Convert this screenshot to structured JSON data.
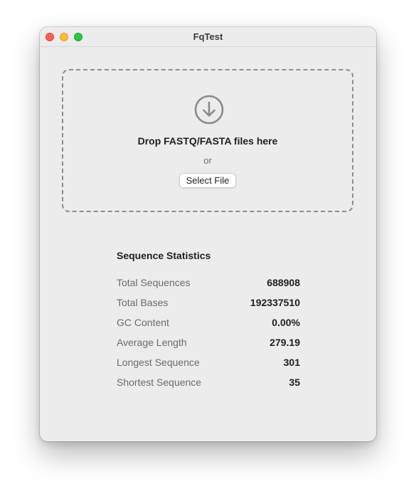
{
  "window": {
    "title": "FqTest",
    "controls": [
      "close",
      "minimize",
      "zoom"
    ]
  },
  "dropzone": {
    "icon": "download-circle-icon",
    "prompt": "Drop FASTQ/FASTA files here",
    "or_text": "or",
    "select_button_label": "Select File"
  },
  "stats": {
    "heading": "Sequence Statistics",
    "rows": [
      {
        "label": "Total Sequences",
        "value": "688908"
      },
      {
        "label": "Total Bases",
        "value": "192337510"
      },
      {
        "label": "GC Content",
        "value": "0.00%"
      },
      {
        "label": "Average Length",
        "value": "279.19"
      },
      {
        "label": "Longest Sequence",
        "value": "301"
      },
      {
        "label": "Shortest Sequence",
        "value": "35"
      }
    ]
  },
  "colors": {
    "close": "#fe5f57",
    "minimize": "#febc2e",
    "zoom": "#28c840",
    "window_background": "#ececec",
    "dashed_border": "#8e8e8e"
  }
}
